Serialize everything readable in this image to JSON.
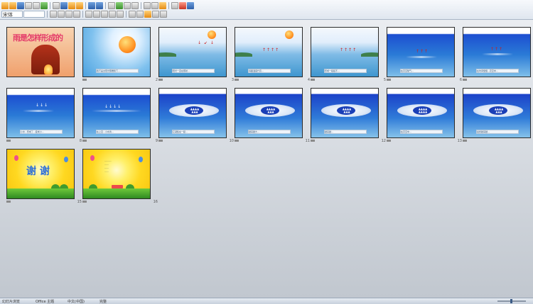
{
  "toolbar": {
    "font_name": "宋体",
    "row1_icons": [
      "new-icon",
      "open-icon",
      "save-icon",
      "print-icon",
      "preview-icon",
      "spell-icon",
      "cut-icon",
      "copy-icon",
      "paste-icon",
      "format-painter-icon",
      "undo-icon",
      "redo-icon",
      "table-icon",
      "chart-icon",
      "zoom-icon",
      "help-icon"
    ],
    "row2_icons": [
      "bold-icon",
      "italic-icon",
      "underline-icon",
      "shadow-icon",
      "align-left-icon",
      "align-center-icon",
      "align-right-icon",
      "bullets-icon",
      "numbering-icon",
      "font-color-icon"
    ]
  },
  "slides": [
    {
      "number": "",
      "title": "雨是怎样形成的"
    },
    {
      "number": "2",
      "caption": "我不是太阳光照耀我下..."
    },
    {
      "number": "3",
      "caption": "阳光一直在照射..."
    },
    {
      "number": "4",
      "caption": "海面温度升高..."
    },
    {
      "number": "5",
      "caption": "形成一段段不..."
    },
    {
      "number": "6",
      "caption": "在高空随气..."
    },
    {
      "number": "7",
      "caption": "在时间慢慢...高空中..."
    },
    {
      "number": "8",
      "caption": "小水...形成了...变成小..."
    },
    {
      "number": "9",
      "caption": "在上空...小水滴..."
    },
    {
      "number": "10",
      "caption": "它凝集在一起..."
    },
    {
      "number": "11",
      "caption": "越来越大..."
    },
    {
      "number": "12",
      "caption": "越来越..."
    },
    {
      "number": "13",
      "caption": "在高空中..."
    },
    {
      "number": "14",
      "caption": "最终越来越..."
    },
    {
      "number": "15",
      "title": "谢 谢"
    },
    {
      "number": "16",
      "lines": [
        "..........",
        "......",
        "......",
        "......"
      ]
    }
  ],
  "status": {
    "slide_indicator": "幻灯片浏览",
    "theme": "Office 主题",
    "language": "中文(中国)",
    "view_label": "完整"
  }
}
